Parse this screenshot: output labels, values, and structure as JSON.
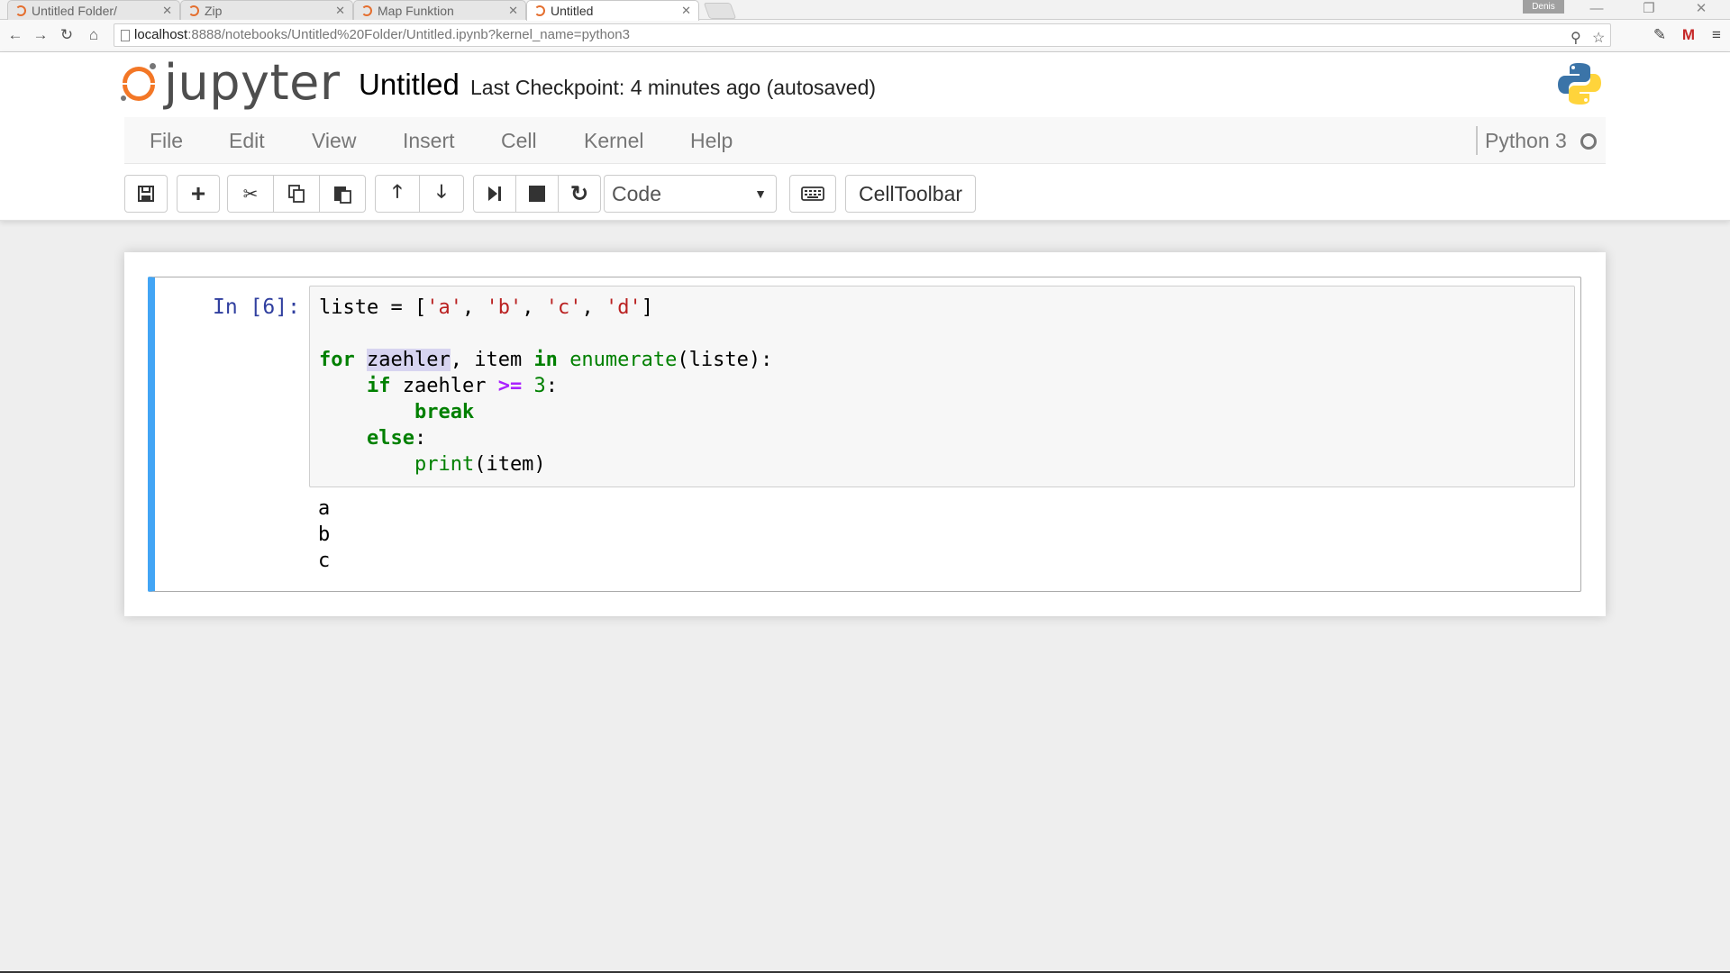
{
  "browser": {
    "tabs": [
      {
        "label": "Untitled Folder/",
        "active": false
      },
      {
        "label": "Zip",
        "active": false
      },
      {
        "label": "Map Funktion",
        "active": false
      },
      {
        "label": "Untitled",
        "active": true
      }
    ],
    "profile": "Denis",
    "url_host": "localhost",
    "url_rest": ":8888/notebooks/Untitled%20Folder/Untitled.ipynb?kernel_name=python3"
  },
  "header": {
    "logo_text": "jupyter",
    "notebook_title": "Untitled",
    "checkpoint": "Last Checkpoint: 4 minutes ago (autosaved)"
  },
  "menu": {
    "items": [
      "File",
      "Edit",
      "View",
      "Insert",
      "Cell",
      "Kernel",
      "Help"
    ],
    "kernel_name": "Python 3"
  },
  "toolbar": {
    "cell_type": "Code",
    "celltoolbar_label": "CellToolbar"
  },
  "cell": {
    "prompt": "In [6]:",
    "output_lines": [
      "a",
      "b",
      "c"
    ]
  },
  "colors": {
    "accent": "#42a5f5",
    "jupyter_orange": "#f37726"
  }
}
